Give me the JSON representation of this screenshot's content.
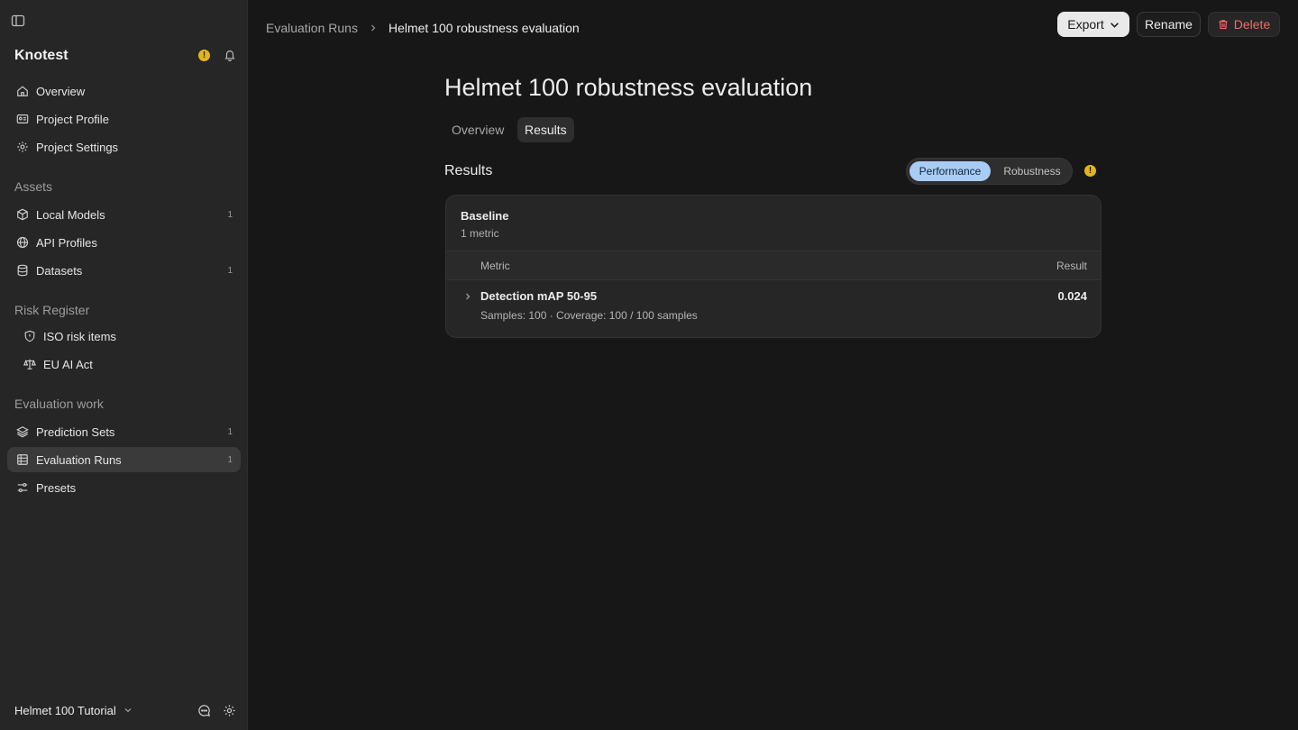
{
  "sidebar": {
    "brand": "Knotest",
    "items_top": [
      {
        "label": "Overview",
        "icon": "home-icon"
      },
      {
        "label": "Project Profile",
        "icon": "id-card-icon"
      },
      {
        "label": "Project Settings",
        "icon": "gear-icon"
      }
    ],
    "sections": {
      "assets": "Assets",
      "risk": "Risk Register",
      "eval": "Evaluation work"
    },
    "assets": [
      {
        "label": "Local Models",
        "count": "1"
      },
      {
        "label": "API Profiles",
        "count": ""
      },
      {
        "label": "Datasets",
        "count": "1"
      }
    ],
    "risk": [
      {
        "label": "ISO risk items"
      },
      {
        "label": "EU AI Act"
      }
    ],
    "eval": [
      {
        "label": "Prediction Sets",
        "count": "1"
      },
      {
        "label": "Evaluation Runs",
        "count": "1"
      },
      {
        "label": "Presets",
        "count": ""
      }
    ],
    "project": "Helmet 100 Tutorial"
  },
  "header": {
    "breadcrumb_parent": "Evaluation Runs",
    "breadcrumb_current": "Helmet 100 robustness evaluation",
    "export_label": "Export",
    "rename_label": "Rename",
    "delete_label": "Delete"
  },
  "main": {
    "title": "Helmet 100 robustness evaluation",
    "tabs": [
      {
        "label": "Overview"
      },
      {
        "label": "Results"
      }
    ],
    "section_title": "Results",
    "toggle": {
      "performance": "Performance",
      "robustness": "Robustness"
    },
    "card": {
      "title": "Baseline",
      "subtitle": "1 metric",
      "col_metric": "Metric",
      "col_result": "Result",
      "rows": [
        {
          "name": "Detection mAP 50-95",
          "meta": "Samples: 100 · Coverage: 100 / 100 samples",
          "value": "0.024"
        }
      ]
    }
  },
  "colors": {
    "accent": "#a8cdf5",
    "warning": "#e3b51d",
    "danger": "#f06a6a"
  }
}
